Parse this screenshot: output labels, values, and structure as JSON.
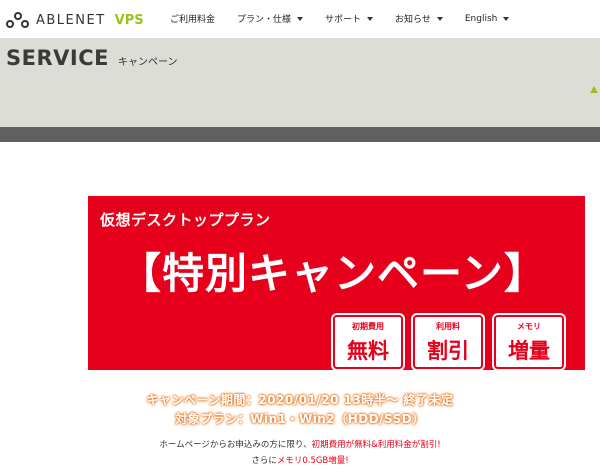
{
  "header": {
    "logo_text": "ABLENET",
    "logo_product": "VPS",
    "nav": [
      {
        "label": "ご利用料金",
        "has_dropdown": false
      },
      {
        "label": "プラン・仕様",
        "has_dropdown": true
      },
      {
        "label": "サポート",
        "has_dropdown": true
      },
      {
        "label": "お知らせ",
        "has_dropdown": true
      },
      {
        "label": "English",
        "has_dropdown": true
      }
    ]
  },
  "service": {
    "title": "SERVICE",
    "subtitle": "キャンペーン"
  },
  "banner": {
    "subtitle": "仮想デスクトッププラン",
    "main_title": "【特別キャンペーン】",
    "badges": [
      {
        "label": "初期費用",
        "value": "無料"
      },
      {
        "label": "利用料",
        "value": "割引"
      },
      {
        "label": "メモリ",
        "value": "増量"
      }
    ]
  },
  "campaign": {
    "period": "キャンペーン期間：2020/01/20 13時半～ 終了未定",
    "target": "対象プラン：Win1・Win2（HDD/SSD）",
    "note1_prefix": "ホームページからお申込みの方に限り、",
    "note1_highlight": "初期費用が無料&利用料金が割引!",
    "note2_prefix": "さらに",
    "note2_highlight": "メモリ0.5GB増量!"
  },
  "colors": {
    "brand_red": "#e6001c",
    "brand_green": "#9ac21a",
    "band_gray": "#dcddd7",
    "dark_band": "#606060",
    "accent_orange": "#e86f1c"
  }
}
